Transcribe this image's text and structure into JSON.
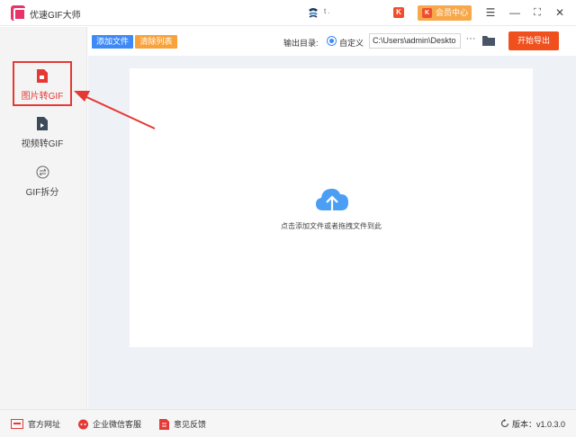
{
  "app": {
    "title": "优速GIF大师"
  },
  "header": {
    "user_name": "t .",
    "vip_label": "会员中心",
    "vip_k": "K",
    "k_badge": "K"
  },
  "window_controls": {
    "menu": "☰",
    "minimize": "—",
    "maximize": "⛶",
    "close": "✕"
  },
  "sidebar": {
    "items": [
      {
        "label": "图片转GIF",
        "icon": "image-file-icon",
        "active": true
      },
      {
        "label": "视频转GIF",
        "icon": "video-file-icon",
        "active": false
      },
      {
        "label": "GIF拆分",
        "icon": "swap-icon",
        "active": false
      }
    ]
  },
  "toolbar": {
    "add_files_label": "添加文件",
    "clear_list_label": "清除列表",
    "output_dir_label": "输出目录:",
    "custom_label": "自定义",
    "path_value": "C:\\Users\\admin\\Deskto",
    "more_label": "···",
    "start_label": "开始导出"
  },
  "dropzone": {
    "hint": "点击添加文件或者拖拽文件到此"
  },
  "footer": {
    "website_label": "官方网址",
    "wechat_label": "企业微信客服",
    "feedback_label": "意见反馈",
    "version_label": "版本：v1.0.3.0"
  },
  "colors": {
    "accent_blue": "#3d8af7",
    "accent_orange": "#f7a23b",
    "start_red": "#f0501e",
    "annotation_red": "#e53935",
    "vip_orange": "#f7a84a"
  }
}
